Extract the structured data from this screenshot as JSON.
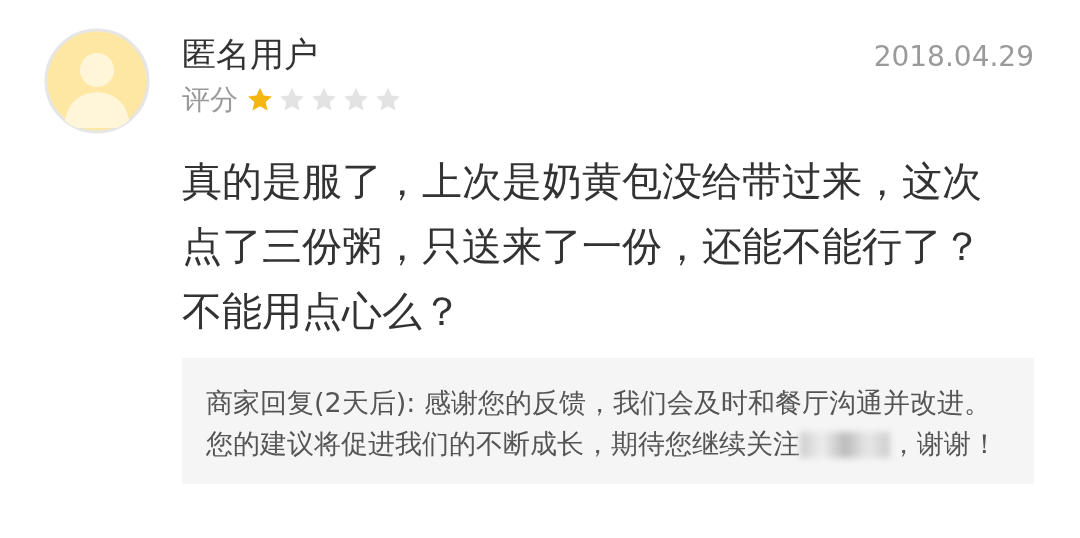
{
  "review": {
    "author": "匿名用户",
    "date": "2018.04.29",
    "rating_label": "评分",
    "stars": 1,
    "text": "真的是服了，上次是奶黄包没给带过来，这次点了三份粥，只送来了一份，还能不能行了？不能用点心么？",
    "reply_start": "商家回复(2天后): 感谢您的反馈，我们会及时和餐厅沟通并改进。您的建议将促进我们的不断成长，期待您继续关注",
    "reply_end": "，谢谢！"
  }
}
